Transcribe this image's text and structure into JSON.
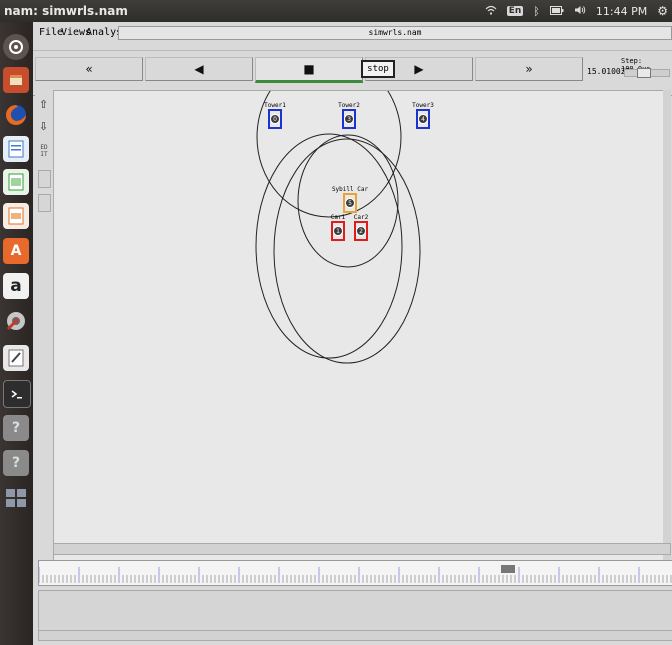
{
  "window": {
    "title": "nam: simwrls.nam"
  },
  "system_status": {
    "wifi_icon": "wifi-icon",
    "keyboard_layout": "En",
    "bluetooth_icon": "bluetooth-icon",
    "battery_icon": "battery-icon",
    "volume_icon": "volume-icon",
    "time": "11:44 PM",
    "settings_icon": "gear-icon"
  },
  "menu": {
    "file": "File",
    "views": "Views",
    "analysis": "Analysis",
    "filename": "simwrls.nam"
  },
  "controls": {
    "rewind_fast": "«",
    "rewind": "◀",
    "stop": "■",
    "play": "▶",
    "fast_forward": "»",
    "stop_tooltip": "stop",
    "sim_time": "15.010029",
    "step_label": "Step: 100.0us"
  },
  "sidebar": {
    "zoom_in_icon": "zoom-in-icon",
    "zoom_out_icon": "zoom-out-icon",
    "edit_label": "ED IT"
  },
  "nodes": [
    {
      "id": "0",
      "label": "Tower1",
      "color": "#1d33d1"
    },
    {
      "id": "3",
      "label": "Tower2",
      "color": "#1d33d1"
    },
    {
      "id": "4",
      "label": "Tower3",
      "color": "#1d33d1"
    },
    {
      "id": "5",
      "label": "Sybill Car",
      "color": "#e8a334"
    },
    {
      "id": "1",
      "label": "Car1",
      "color": "#e01c1c"
    },
    {
      "id": "2",
      "label": "Car2",
      "color": "#e01c1c"
    }
  ],
  "colors": {
    "accent_green": "#3b8a3b",
    "canvas_bg": "#e8e8e8",
    "node_fill": "#3c3c3c"
  }
}
